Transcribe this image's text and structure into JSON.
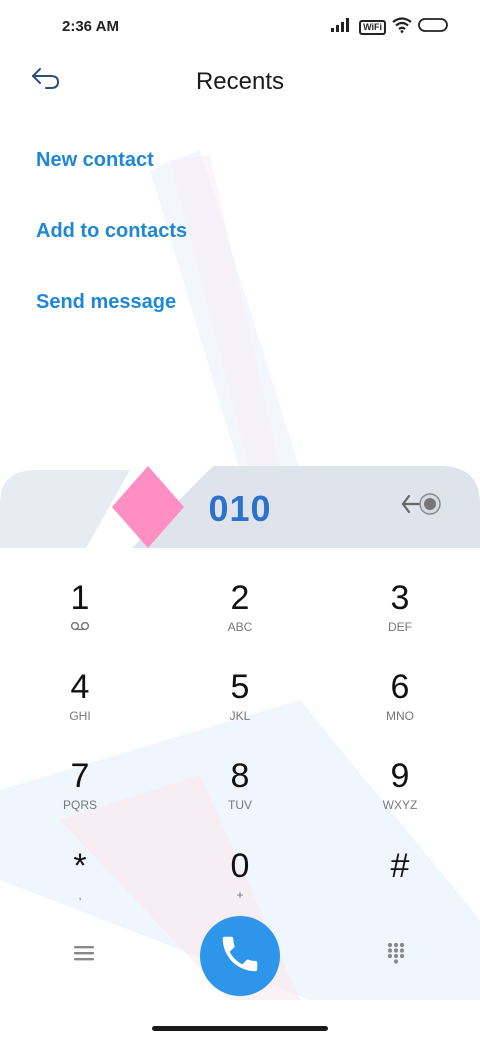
{
  "status_bar": {
    "time": "2:36 AM",
    "wifi_badge": "WiFi"
  },
  "header": {
    "title": "Recents",
    "back_icon": "back-arrow-icon"
  },
  "actions": [
    {
      "label": "New contact"
    },
    {
      "label": "Add to contacts"
    },
    {
      "label": "Send message"
    }
  ],
  "dialer": {
    "number": "010",
    "backspace_icon": "backspace-icon"
  },
  "keypad": [
    {
      "digit": "1",
      "letters": ""
    },
    {
      "digit": "2",
      "letters": "ABC"
    },
    {
      "digit": "3",
      "letters": "DEF"
    },
    {
      "digit": "4",
      "letters": "GHI"
    },
    {
      "digit": "5",
      "letters": "JKL"
    },
    {
      "digit": "6",
      "letters": "MNO"
    },
    {
      "digit": "7",
      "letters": "PQRS"
    },
    {
      "digit": "8",
      "letters": "TUV"
    },
    {
      "digit": "9",
      "letters": "WXYZ"
    },
    {
      "digit": "*",
      "letters": ","
    },
    {
      "digit": "0",
      "letters": "+"
    },
    {
      "digit": "#",
      "letters": ""
    }
  ],
  "bottom_bar": {
    "menu_icon": "menu-icon",
    "call_icon": "phone-icon",
    "dialpad_icon": "dialpad-icon"
  },
  "colors": {
    "accent": "#1e88d6",
    "call_button": "#2d95ea",
    "number": "#2a72cc",
    "diamond": "#ff8ec2"
  }
}
